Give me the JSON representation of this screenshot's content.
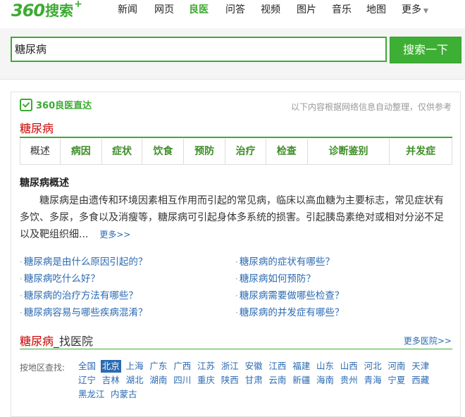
{
  "logo": {
    "number": "360",
    "word": "搜索",
    "plus": "+"
  },
  "nav": [
    {
      "label": "新闻"
    },
    {
      "label": "网页"
    },
    {
      "label": "良医"
    },
    {
      "label": "问答"
    },
    {
      "label": "视频"
    },
    {
      "label": "图片"
    },
    {
      "label": "音乐"
    },
    {
      "label": "地图"
    },
    {
      "label": "更多"
    }
  ],
  "active_nav": "良医",
  "search": {
    "query": "糖尿病",
    "button": "搜索一下"
  },
  "card": {
    "brand": "360良医直达",
    "disclaimer": "以下内容根据网络信息自动整理，仅供参考",
    "disease": "糖尿病",
    "tabs": [
      "概述",
      "病因",
      "症状",
      "饮食",
      "预防",
      "治疗",
      "检查",
      "诊断鉴别",
      "并发症"
    ],
    "section_title": "糖尿病概述",
    "overview": "糖尿病是由遗传和环境因素相互作用而引起的常见病，临床以高血糖为主要标志，常见症状有多饮、多尿，多食以及消瘦等，糖尿病可引起身体多系统的损害。引起胰岛素绝对或相对分泌不足以及靶组织细...",
    "more": "更多>>",
    "questions": [
      "糖尿病是由什么原因引起的？",
      "糖尿病的症状有哪些？",
      "糖尿病吃什么好？",
      "糖尿病如何预防？",
      "糖尿病的治疗方法有哪些？",
      "糖尿病需要做哪些检查？",
      "糖尿病容易与哪些疾病混淆？",
      "糖尿病的并发症有哪些？"
    ],
    "find_hospital": {
      "disease": "糖尿病",
      "suffix": "_找医院",
      "more": "更多医院>>"
    },
    "region_label": "按地区查找:",
    "regions_row1": [
      "全国",
      "北京",
      "上海",
      "广东",
      "广西",
      "江苏",
      "浙江",
      "安徽",
      "江西",
      "福建",
      "山东",
      "山西",
      "河北",
      "河南",
      "天津"
    ],
    "regions_row2": [
      "辽宁",
      "吉林",
      "湖北",
      "湖南",
      "四川",
      "重庆",
      "陕西",
      "甘肃",
      "云南",
      "新疆",
      "海南",
      "贵州",
      "青海",
      "宁夏",
      "西藏"
    ],
    "regions_row3": [
      "黑龙江",
      "内蒙古"
    ],
    "active_region": "北京"
  },
  "colors": {
    "brand_green": "#3bab31",
    "link_blue": "#2b6ab2",
    "title_red": "#cc0000"
  }
}
